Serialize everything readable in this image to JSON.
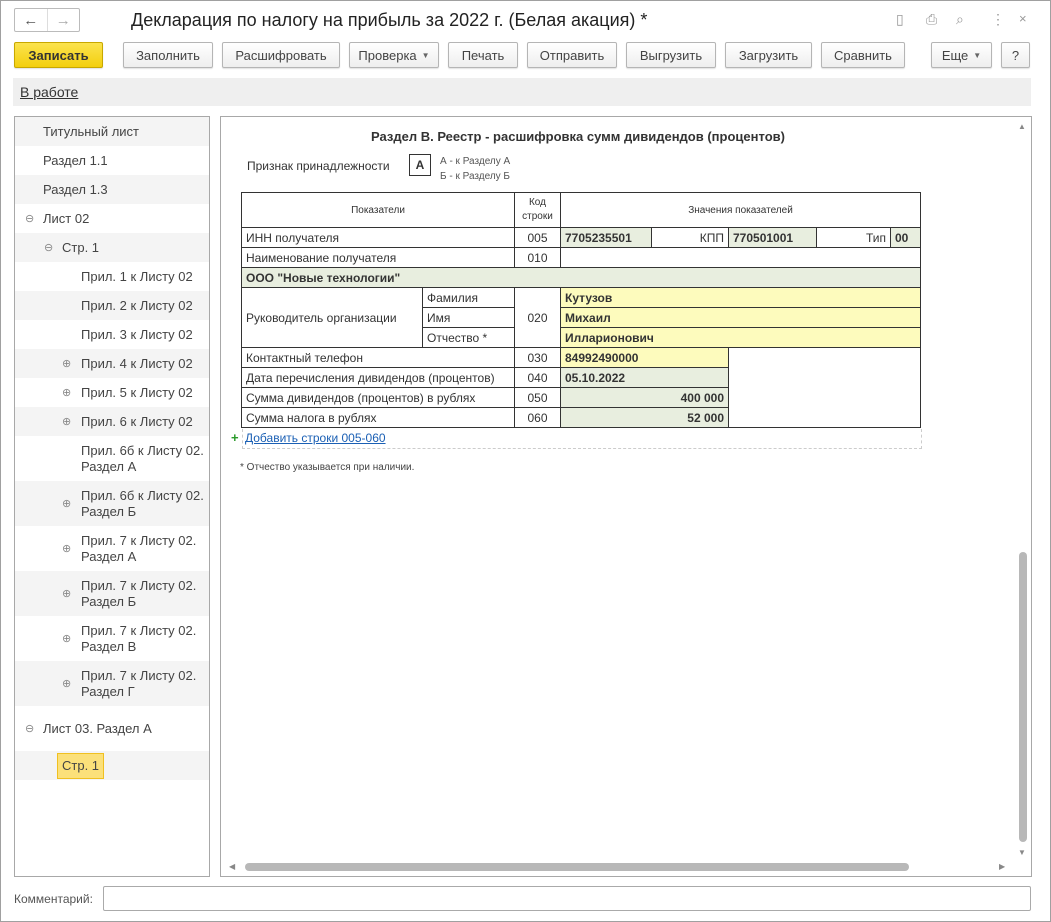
{
  "window": {
    "title": "Декларация по налогу на прибыль за 2022 г. (Белая акация) *",
    "back": "←",
    "forward": "→",
    "icons": [
      "save-icon",
      "print-icon",
      "preview-icon",
      "more-icon",
      "close-icon"
    ]
  },
  "toolbar": {
    "save": "Записать",
    "fill": "Заполнить",
    "decode": "Расшифровать",
    "check": "Проверка",
    "print": "Печать",
    "send": "Отправить",
    "export": "Выгрузить",
    "import": "Загрузить",
    "compare": "Сравнить",
    "more": "Еще",
    "help": "?"
  },
  "status": {
    "link": "В работе"
  },
  "tree": [
    {
      "label": "Титульный лист",
      "level": 0,
      "exp": ""
    },
    {
      "label": "Раздел 1.1",
      "level": 0,
      "exp": ""
    },
    {
      "label": "Раздел 1.3",
      "level": 0,
      "exp": ""
    },
    {
      "label": "Лист 02",
      "level": 0,
      "exp": "⊖"
    },
    {
      "label": "Стр. 1",
      "level": 1,
      "exp": "⊖"
    },
    {
      "label": "Прил. 1 к Листу 02",
      "level": 2,
      "exp": ""
    },
    {
      "label": "Прил. 2 к Листу 02",
      "level": 2,
      "exp": ""
    },
    {
      "label": "Прил. 3 к Листу 02",
      "level": 2,
      "exp": ""
    },
    {
      "label": "Прил. 4 к Листу 02",
      "level": 2,
      "exp": "⊕"
    },
    {
      "label": "Прил. 5 к Листу 02",
      "level": 2,
      "exp": "⊕"
    },
    {
      "label": "Прил. 6 к Листу 02",
      "level": 2,
      "exp": "⊕"
    },
    {
      "label": "Прил. 6б к Листу 02. Раздел А",
      "level": 2,
      "exp": ""
    },
    {
      "label": "Прил. 6б к Листу 02. Раздел Б",
      "level": 2,
      "exp": "⊕"
    },
    {
      "label": "Прил. 7 к Листу 02. Раздел А",
      "level": 2,
      "exp": "⊕"
    },
    {
      "label": "Прил. 7 к Листу 02. Раздел Б",
      "level": 2,
      "exp": "⊕"
    },
    {
      "label": "Прил. 7 к Листу 02. Раздел В",
      "level": 2,
      "exp": "⊕"
    },
    {
      "label": "Прил. 7 к Листу 02. Раздел Г",
      "level": 2,
      "exp": "⊕"
    },
    {
      "label": "Лист 03. Раздел А",
      "level": 0,
      "exp": "⊖"
    },
    {
      "label": "Стр. 1",
      "level": 1,
      "exp": "",
      "selected": true
    }
  ],
  "form": {
    "heading": "Раздел В. Реестр - расшифровка сумм дивидендов (процентов)",
    "sign_label": "Признак принадлежности",
    "sign_value": "А",
    "sign_hint_a": "А - к Разделу А",
    "sign_hint_b": "Б - к Разделу Б",
    "headers": {
      "indicators": "Показатели",
      "code": "Код строки",
      "values": "Значения показателей"
    },
    "inn": {
      "label": "ИНН получателя",
      "code": "005",
      "value": "7705235501",
      "kpp_label": "КПП",
      "kpp": "770501001",
      "type_label": "Тип",
      "type": "00"
    },
    "name": {
      "label": "Наименование получателя",
      "code": "010",
      "value": "ООО \"Новые технологии\""
    },
    "head": {
      "label": "Руководитель организации",
      "code": "020",
      "last_label": "Фамилия",
      "last": "Кутузов",
      "first_label": "Имя",
      "first": "Михаил",
      "middle_label": "Отчество *",
      "middle": "Илларионович"
    },
    "phone": {
      "label": "Контактный телефон",
      "code": "030",
      "value": "84992490000"
    },
    "date": {
      "label": "Дата перечисления дивидендов (процентов)",
      "code": "040",
      "value": "05.10.2022"
    },
    "sum": {
      "label": "Сумма дивидендов (процентов) в рублях",
      "code": "050",
      "value": "400 000"
    },
    "tax": {
      "label": "Сумма налога в рублях",
      "code": "060",
      "value": "52 000"
    },
    "add_rows": "Добавить строки 005-060",
    "footnote": "* Отчество указывается при наличии."
  },
  "comment": {
    "label": "Комментарий:",
    "value": ""
  },
  "colors": {
    "primary_button": "#f3d51a",
    "filled_field": "#e8eedf",
    "editable_field": "#fdfbbd",
    "selected_tree": "#fbe07a"
  }
}
